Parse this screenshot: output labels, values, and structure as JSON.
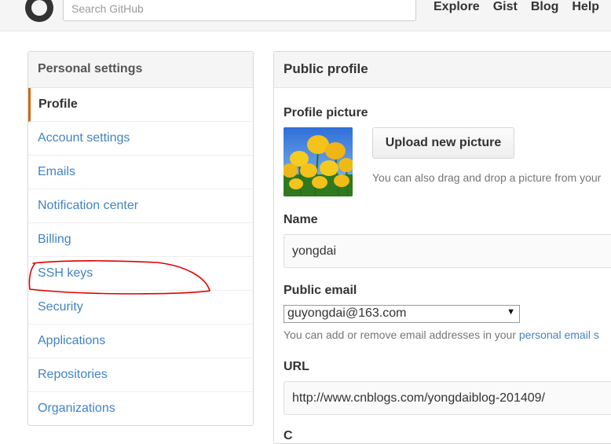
{
  "header": {
    "search_placeholder": "Search GitHub",
    "nav": [
      "Explore",
      "Gist",
      "Blog",
      "Help"
    ]
  },
  "sidebar": {
    "title": "Personal settings",
    "items": [
      {
        "label": "Profile"
      },
      {
        "label": "Account settings"
      },
      {
        "label": "Emails"
      },
      {
        "label": "Notification center"
      },
      {
        "label": "Billing"
      },
      {
        "label": "SSH keys"
      },
      {
        "label": "Security"
      },
      {
        "label": "Applications"
      },
      {
        "label": "Repositories"
      },
      {
        "label": "Organizations"
      }
    ]
  },
  "main": {
    "title": "Public profile",
    "profile_picture_label": "Profile picture",
    "upload_button": "Upload new picture",
    "upload_hint": "You can also drag and drop a picture from your",
    "name_label": "Name",
    "name_value": "yongdai",
    "public_email_label": "Public email",
    "public_email_value": "guyongdai@163.com",
    "email_hint": "You can add or remove email addresses in your ",
    "email_hint_link": "personal email s",
    "url_label": "URL",
    "url_value": "http://www.cnblogs.com/yongdaiblog-201409/",
    "partial_label": "C"
  },
  "colors": {
    "link": "#4183c4",
    "selected_accent": "#d26911",
    "annotation": "#e00000"
  }
}
